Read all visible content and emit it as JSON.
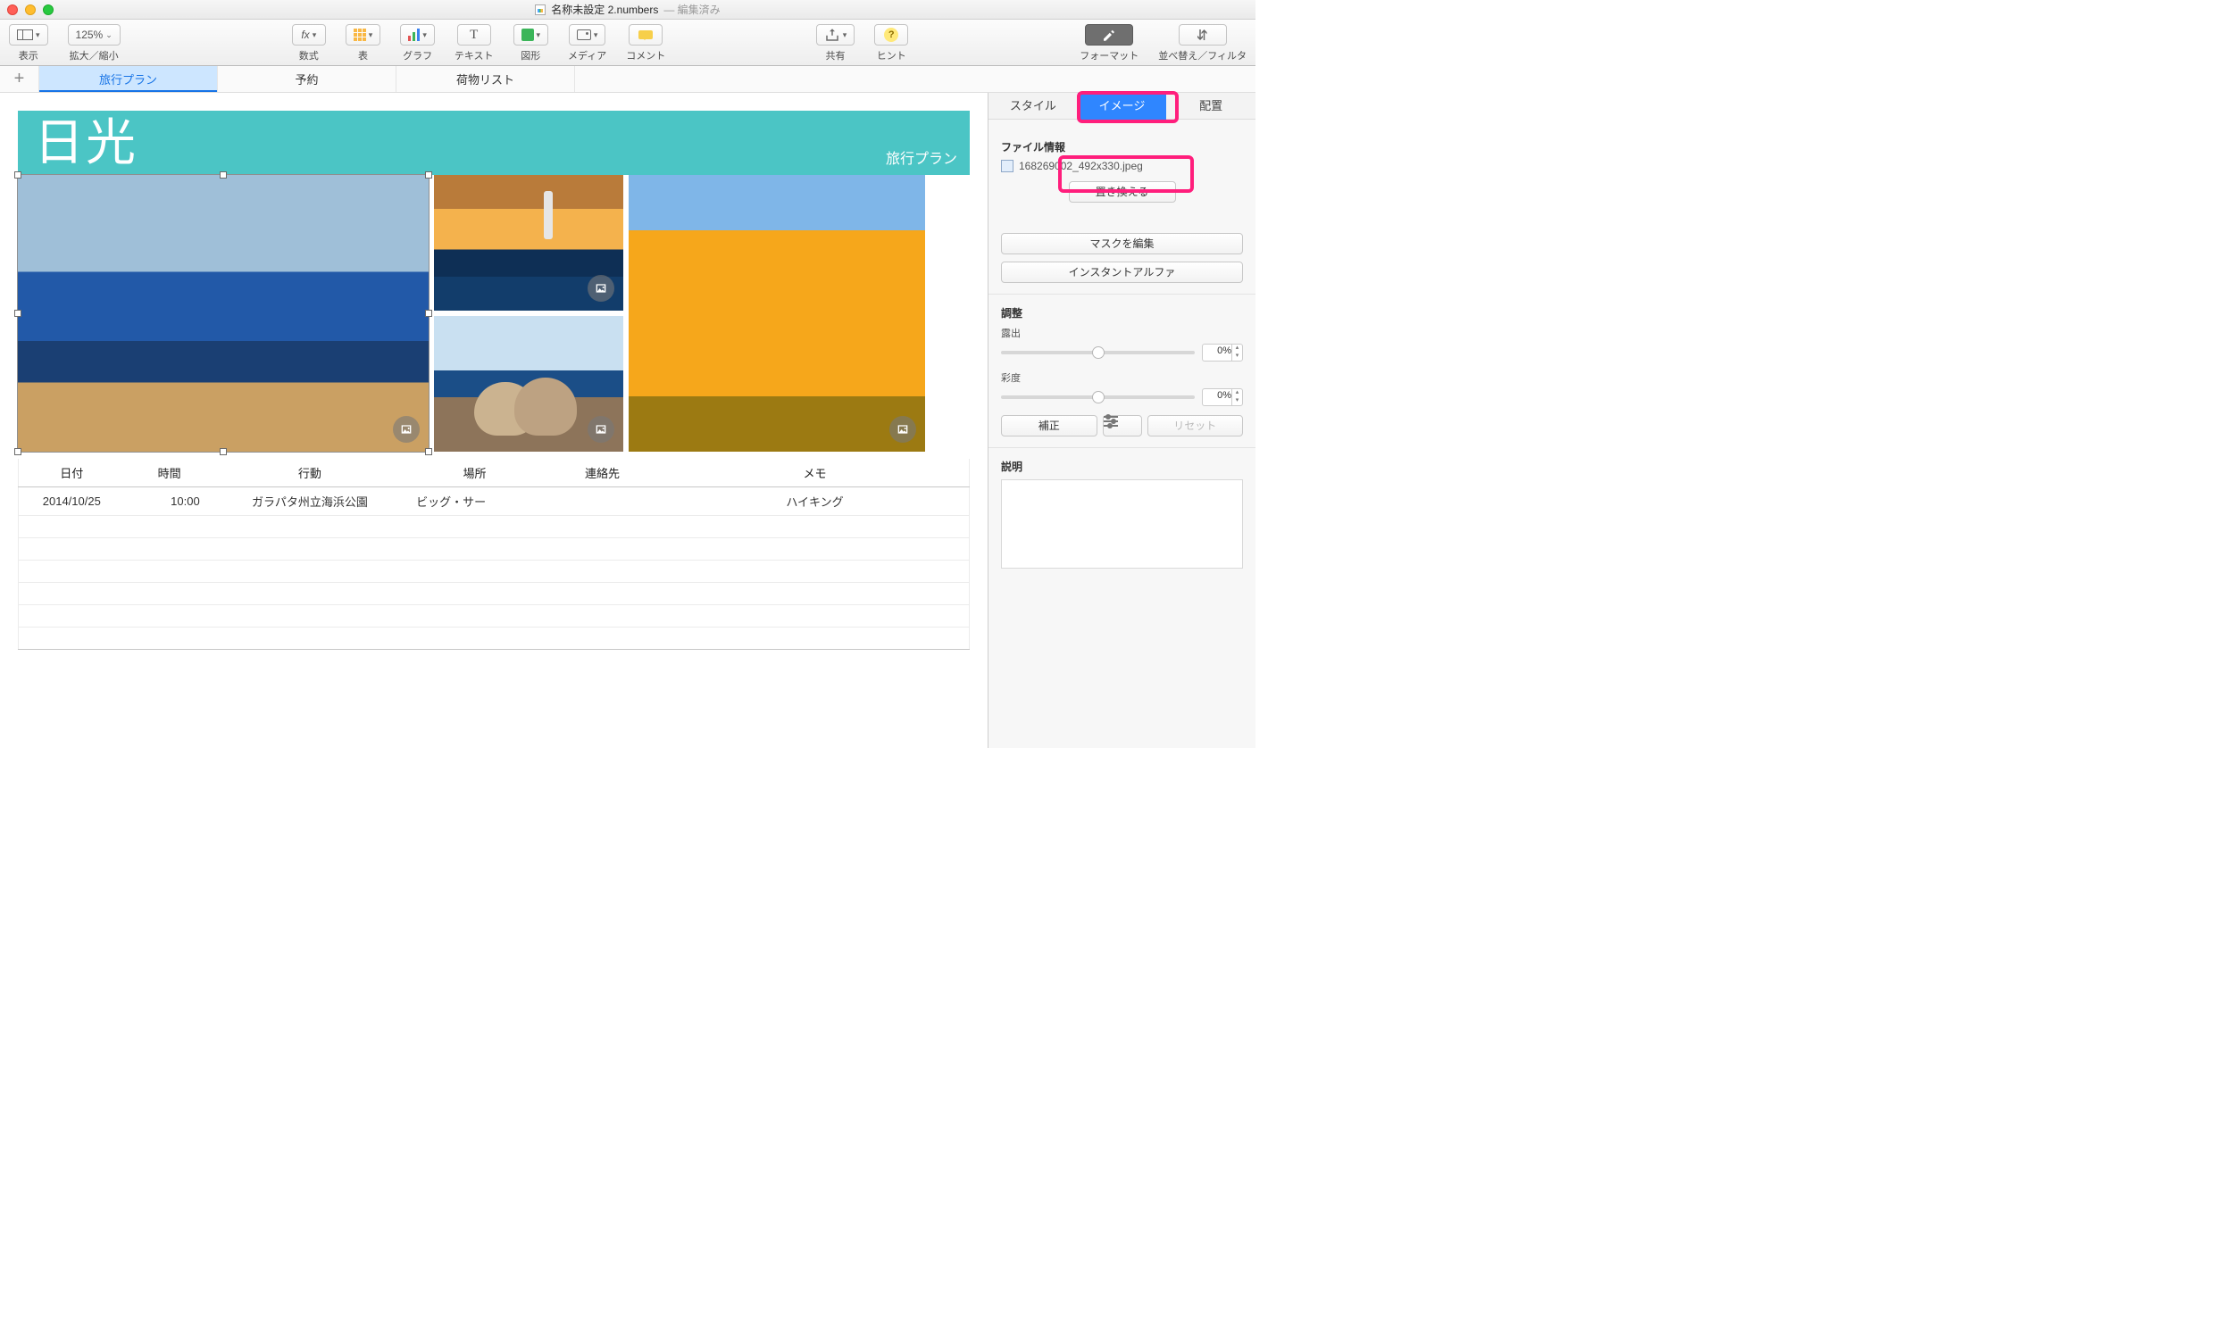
{
  "title": {
    "filename": "名称未設定 2.numbers",
    "status": "編集済み"
  },
  "toolbar": {
    "view": "表示",
    "zoom_value": "125%",
    "zoom": "拡大／縮小",
    "formula": "数式",
    "table": "表",
    "chart": "グラフ",
    "text": "テキスト",
    "shape": "図形",
    "media": "メディア",
    "comment": "コメント",
    "share": "共有",
    "hint": "ヒント",
    "format": "フォーマット",
    "sort": "並べ替え／フィルタ"
  },
  "sheets": [
    "旅行プラン",
    "予約",
    "荷物リスト"
  ],
  "banner": {
    "title": "日光",
    "subtitle": "旅行プラン"
  },
  "table": {
    "headers": [
      "日付",
      "時間",
      "行動",
      "場所",
      "連絡先",
      "メモ"
    ],
    "rows": [
      {
        "date": "2014/10/25",
        "time": "10:00",
        "action": "ガラパタ州立海浜公園",
        "place": "ビッグ・サー",
        "contact": "",
        "memo": "ハイキング"
      }
    ]
  },
  "inspector": {
    "tabs": {
      "style": "スタイル",
      "image": "イメージ",
      "arrange": "配置"
    },
    "file_info_label": "ファイル情報",
    "filename": "168269002_492x330.jpeg",
    "replace": "置き換える",
    "edit_mask": "マスクを編集",
    "instant_alpha": "インスタントアルファ",
    "adjust": "調整",
    "exposure": "露出",
    "exposure_value": "0%",
    "saturation": "彩度",
    "saturation_value": "0%",
    "enhance": "補正",
    "reset": "リセット",
    "description": "説明"
  }
}
